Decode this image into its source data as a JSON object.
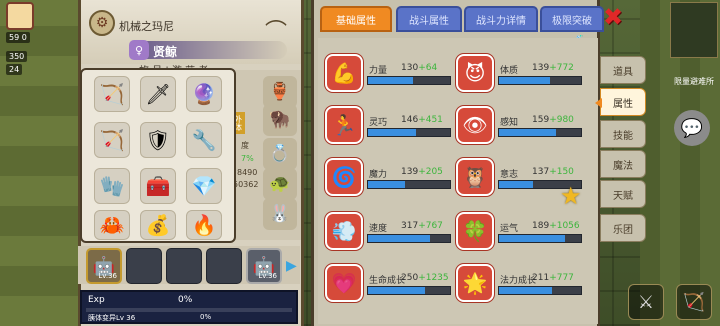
{
  "character": {
    "name": "机械之玛尼",
    "class_name": "贤鲸",
    "sub_title": "旅 号 | 游 荡 者",
    "side_tag": "外体",
    "side_text_1": "度",
    "side_text_2": "7%",
    "side_text_3": "8490",
    "side_text_4": "50362"
  },
  "hud": {
    "top_number": "59 0",
    "coins": "350",
    "gems": "24"
  },
  "minimap": {
    "label": "限量避难所"
  },
  "equipment": [
    {
      "icon": "🏹",
      "name": "crossbow"
    },
    {
      "icon": "🗡",
      "name": "spear"
    },
    {
      "icon": "🔮",
      "name": "staff"
    },
    {
      "icon": "🏹",
      "name": "bow"
    },
    {
      "icon": "🛡",
      "name": "shield"
    },
    {
      "icon": "🔧",
      "name": "wrench"
    },
    {
      "icon": "🧤",
      "name": "glove"
    },
    {
      "icon": "🧰",
      "name": "chest-armor"
    },
    {
      "icon": "💎",
      "name": "bracer"
    },
    {
      "icon": "🦀",
      "name": "crab-charm"
    },
    {
      "icon": "💰",
      "name": "gold-pile"
    },
    {
      "icon": "🔥",
      "name": "fire-rune"
    }
  ],
  "side_slots": [
    {
      "icon": "🏺",
      "name": "relic"
    },
    {
      "icon": "🦬",
      "name": "pet"
    },
    {
      "icon": "💍",
      "name": "ring"
    },
    {
      "icon": "🐰",
      "name": "bunny"
    }
  ],
  "skills": {
    "first_level": "Lv.36",
    "last_level": "Lv.36"
  },
  "exp": {
    "label": "Exp",
    "percent": "0%",
    "sub_label": "胰体变异Lv 36",
    "sub_percent": "0%"
  },
  "tabs": [
    {
      "label": "基础属性",
      "active": true
    },
    {
      "label": "战斗属性",
      "active": false
    },
    {
      "label": "战斗力详情",
      "active": false
    },
    {
      "label": "极限突破",
      "active": false
    }
  ],
  "stats": [
    {
      "name": "力量",
      "base": "130",
      "bonus": "+64",
      "icon": "💪",
      "fill": 0.55
    },
    {
      "name": "体质",
      "base": "139",
      "bonus": "+772",
      "icon": "😈",
      "fill": 0.62
    },
    {
      "name": "灵巧",
      "base": "146",
      "bonus": "+451",
      "icon": "🏃",
      "fill": 0.58
    },
    {
      "name": "感知",
      "base": "159",
      "bonus": "+980",
      "icon": "👁",
      "fill": 0.7
    },
    {
      "name": "魔力",
      "base": "139",
      "bonus": "+205",
      "icon": "🌀",
      "fill": 0.45
    },
    {
      "name": "意志",
      "base": "137",
      "bonus": "+150",
      "icon": "🦉",
      "fill": 0.42
    },
    {
      "name": "速度",
      "base": "317",
      "bonus": "+767",
      "icon": "💨",
      "fill": 0.75
    },
    {
      "name": "运气",
      "base": "189",
      "bonus": "+1056",
      "icon": "🍀",
      "fill": 0.8
    },
    {
      "name": "生命成长",
      "base": "250",
      "bonus": "+1235",
      "icon": "💗",
      "fill": 0.7
    },
    {
      "name": "法力成长",
      "base": "211",
      "bonus": "+777",
      "icon": "🌟",
      "fill": 0.65
    }
  ],
  "side_menu": [
    {
      "label": "道具",
      "active": false
    },
    {
      "label": "属性",
      "active": true
    },
    {
      "label": "技能",
      "active": false
    },
    {
      "label": "魔法",
      "active": false
    },
    {
      "label": "天赋",
      "active": false
    },
    {
      "label": "乐团",
      "active": false
    }
  ],
  "colors": {
    "tab_active": "#f08a22",
    "tab_inactive": "#5a73c8",
    "stat_icon": "#d64a3a",
    "stat_fill": "#3a8fe0",
    "bonus_green": "#3db53d",
    "close_red": "#e02828"
  }
}
